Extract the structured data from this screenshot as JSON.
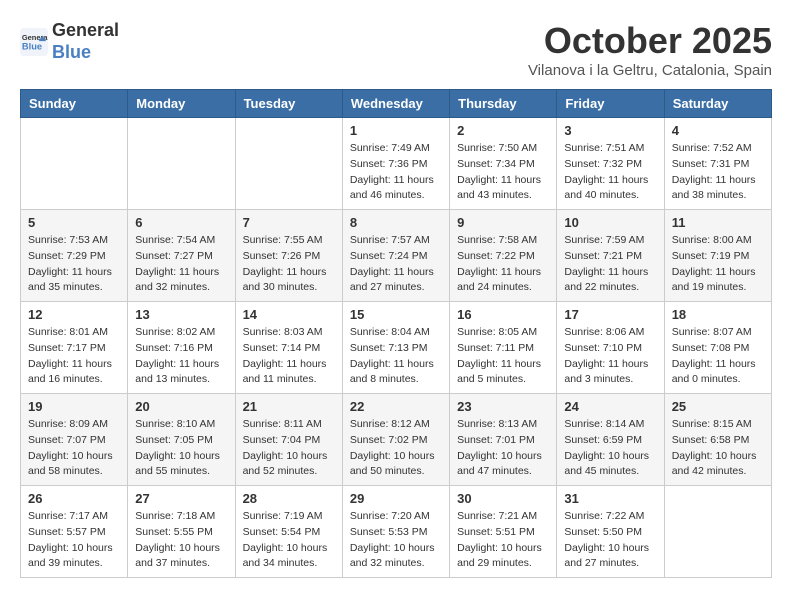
{
  "header": {
    "logo_line1": "General",
    "logo_line2": "Blue",
    "month": "October 2025",
    "location": "Vilanova i la Geltru, Catalonia, Spain"
  },
  "weekdays": [
    "Sunday",
    "Monday",
    "Tuesday",
    "Wednesday",
    "Thursday",
    "Friday",
    "Saturday"
  ],
  "weeks": [
    [
      {
        "day": "",
        "info": ""
      },
      {
        "day": "",
        "info": ""
      },
      {
        "day": "",
        "info": ""
      },
      {
        "day": "1",
        "info": "Sunrise: 7:49 AM\nSunset: 7:36 PM\nDaylight: 11 hours\nand 46 minutes."
      },
      {
        "day": "2",
        "info": "Sunrise: 7:50 AM\nSunset: 7:34 PM\nDaylight: 11 hours\nand 43 minutes."
      },
      {
        "day": "3",
        "info": "Sunrise: 7:51 AM\nSunset: 7:32 PM\nDaylight: 11 hours\nand 40 minutes."
      },
      {
        "day": "4",
        "info": "Sunrise: 7:52 AM\nSunset: 7:31 PM\nDaylight: 11 hours\nand 38 minutes."
      }
    ],
    [
      {
        "day": "5",
        "info": "Sunrise: 7:53 AM\nSunset: 7:29 PM\nDaylight: 11 hours\nand 35 minutes."
      },
      {
        "day": "6",
        "info": "Sunrise: 7:54 AM\nSunset: 7:27 PM\nDaylight: 11 hours\nand 32 minutes."
      },
      {
        "day": "7",
        "info": "Sunrise: 7:55 AM\nSunset: 7:26 PM\nDaylight: 11 hours\nand 30 minutes."
      },
      {
        "day": "8",
        "info": "Sunrise: 7:57 AM\nSunset: 7:24 PM\nDaylight: 11 hours\nand 27 minutes."
      },
      {
        "day": "9",
        "info": "Sunrise: 7:58 AM\nSunset: 7:22 PM\nDaylight: 11 hours\nand 24 minutes."
      },
      {
        "day": "10",
        "info": "Sunrise: 7:59 AM\nSunset: 7:21 PM\nDaylight: 11 hours\nand 22 minutes."
      },
      {
        "day": "11",
        "info": "Sunrise: 8:00 AM\nSunset: 7:19 PM\nDaylight: 11 hours\nand 19 minutes."
      }
    ],
    [
      {
        "day": "12",
        "info": "Sunrise: 8:01 AM\nSunset: 7:17 PM\nDaylight: 11 hours\nand 16 minutes."
      },
      {
        "day": "13",
        "info": "Sunrise: 8:02 AM\nSunset: 7:16 PM\nDaylight: 11 hours\nand 13 minutes."
      },
      {
        "day": "14",
        "info": "Sunrise: 8:03 AM\nSunset: 7:14 PM\nDaylight: 11 hours\nand 11 minutes."
      },
      {
        "day": "15",
        "info": "Sunrise: 8:04 AM\nSunset: 7:13 PM\nDaylight: 11 hours\nand 8 minutes."
      },
      {
        "day": "16",
        "info": "Sunrise: 8:05 AM\nSunset: 7:11 PM\nDaylight: 11 hours\nand 5 minutes."
      },
      {
        "day": "17",
        "info": "Sunrise: 8:06 AM\nSunset: 7:10 PM\nDaylight: 11 hours\nand 3 minutes."
      },
      {
        "day": "18",
        "info": "Sunrise: 8:07 AM\nSunset: 7:08 PM\nDaylight: 11 hours\nand 0 minutes."
      }
    ],
    [
      {
        "day": "19",
        "info": "Sunrise: 8:09 AM\nSunset: 7:07 PM\nDaylight: 10 hours\nand 58 minutes."
      },
      {
        "day": "20",
        "info": "Sunrise: 8:10 AM\nSunset: 7:05 PM\nDaylight: 10 hours\nand 55 minutes."
      },
      {
        "day": "21",
        "info": "Sunrise: 8:11 AM\nSunset: 7:04 PM\nDaylight: 10 hours\nand 52 minutes."
      },
      {
        "day": "22",
        "info": "Sunrise: 8:12 AM\nSunset: 7:02 PM\nDaylight: 10 hours\nand 50 minutes."
      },
      {
        "day": "23",
        "info": "Sunrise: 8:13 AM\nSunset: 7:01 PM\nDaylight: 10 hours\nand 47 minutes."
      },
      {
        "day": "24",
        "info": "Sunrise: 8:14 AM\nSunset: 6:59 PM\nDaylight: 10 hours\nand 45 minutes."
      },
      {
        "day": "25",
        "info": "Sunrise: 8:15 AM\nSunset: 6:58 PM\nDaylight: 10 hours\nand 42 minutes."
      }
    ],
    [
      {
        "day": "26",
        "info": "Sunrise: 7:17 AM\nSunset: 5:57 PM\nDaylight: 10 hours\nand 39 minutes."
      },
      {
        "day": "27",
        "info": "Sunrise: 7:18 AM\nSunset: 5:55 PM\nDaylight: 10 hours\nand 37 minutes."
      },
      {
        "day": "28",
        "info": "Sunrise: 7:19 AM\nSunset: 5:54 PM\nDaylight: 10 hours\nand 34 minutes."
      },
      {
        "day": "29",
        "info": "Sunrise: 7:20 AM\nSunset: 5:53 PM\nDaylight: 10 hours\nand 32 minutes."
      },
      {
        "day": "30",
        "info": "Sunrise: 7:21 AM\nSunset: 5:51 PM\nDaylight: 10 hours\nand 29 minutes."
      },
      {
        "day": "31",
        "info": "Sunrise: 7:22 AM\nSunset: 5:50 PM\nDaylight: 10 hours\nand 27 minutes."
      },
      {
        "day": "",
        "info": ""
      }
    ]
  ]
}
